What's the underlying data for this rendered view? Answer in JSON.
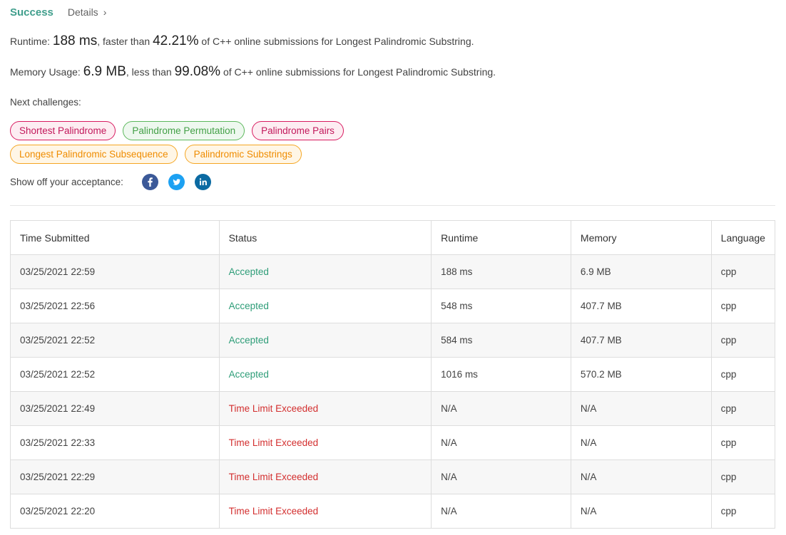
{
  "header": {
    "status": "Success",
    "details_label": "Details",
    "details_chevron": "›"
  },
  "runtime": {
    "label": "Runtime: ",
    "value": "188 ms",
    "mid": ", faster than ",
    "percent": "42.21%",
    "tail": " of C++ online submissions for Longest Palindromic Substring."
  },
  "memory": {
    "label": "Memory Usage: ",
    "value": "6.9 MB",
    "mid": ", less than ",
    "percent": "99.08%",
    "tail": " of C++ online submissions for Longest Palindromic Substring."
  },
  "next_challenges": {
    "label": "Next challenges:",
    "items": [
      {
        "label": "Shortest Palindrome",
        "difficulty": "hard"
      },
      {
        "label": "Palindrome Permutation",
        "difficulty": "easy"
      },
      {
        "label": "Palindrome Pairs",
        "difficulty": "hard"
      },
      {
        "label": "Longest Palindromic Subsequence",
        "difficulty": "medium"
      },
      {
        "label": "Palindromic Substrings",
        "difficulty": "medium"
      }
    ]
  },
  "share": {
    "label": "Show off your acceptance:",
    "icons": [
      "facebook-icon",
      "twitter-icon",
      "linkedin-icon"
    ]
  },
  "colors": {
    "accepted": "#2e9d78",
    "tle": "#d32f2f",
    "success": "#409e8c"
  },
  "table": {
    "headers": [
      "Time Submitted",
      "Status",
      "Runtime",
      "Memory",
      "Language"
    ],
    "rows": [
      [
        "03/25/2021 22:59",
        "Accepted",
        "188 ms",
        "6.9 MB",
        "cpp"
      ],
      [
        "03/25/2021 22:56",
        "Accepted",
        "548 ms",
        "407.7 MB",
        "cpp"
      ],
      [
        "03/25/2021 22:52",
        "Accepted",
        "584 ms",
        "407.7 MB",
        "cpp"
      ],
      [
        "03/25/2021 22:52",
        "Accepted",
        "1016 ms",
        "570.2 MB",
        "cpp"
      ],
      [
        "03/25/2021 22:49",
        "Time Limit Exceeded",
        "N/A",
        "N/A",
        "cpp"
      ],
      [
        "03/25/2021 22:33",
        "Time Limit Exceeded",
        "N/A",
        "N/A",
        "cpp"
      ],
      [
        "03/25/2021 22:29",
        "Time Limit Exceeded",
        "N/A",
        "N/A",
        "cpp"
      ],
      [
        "03/25/2021 22:20",
        "Time Limit Exceeded",
        "N/A",
        "N/A",
        "cpp"
      ]
    ]
  }
}
